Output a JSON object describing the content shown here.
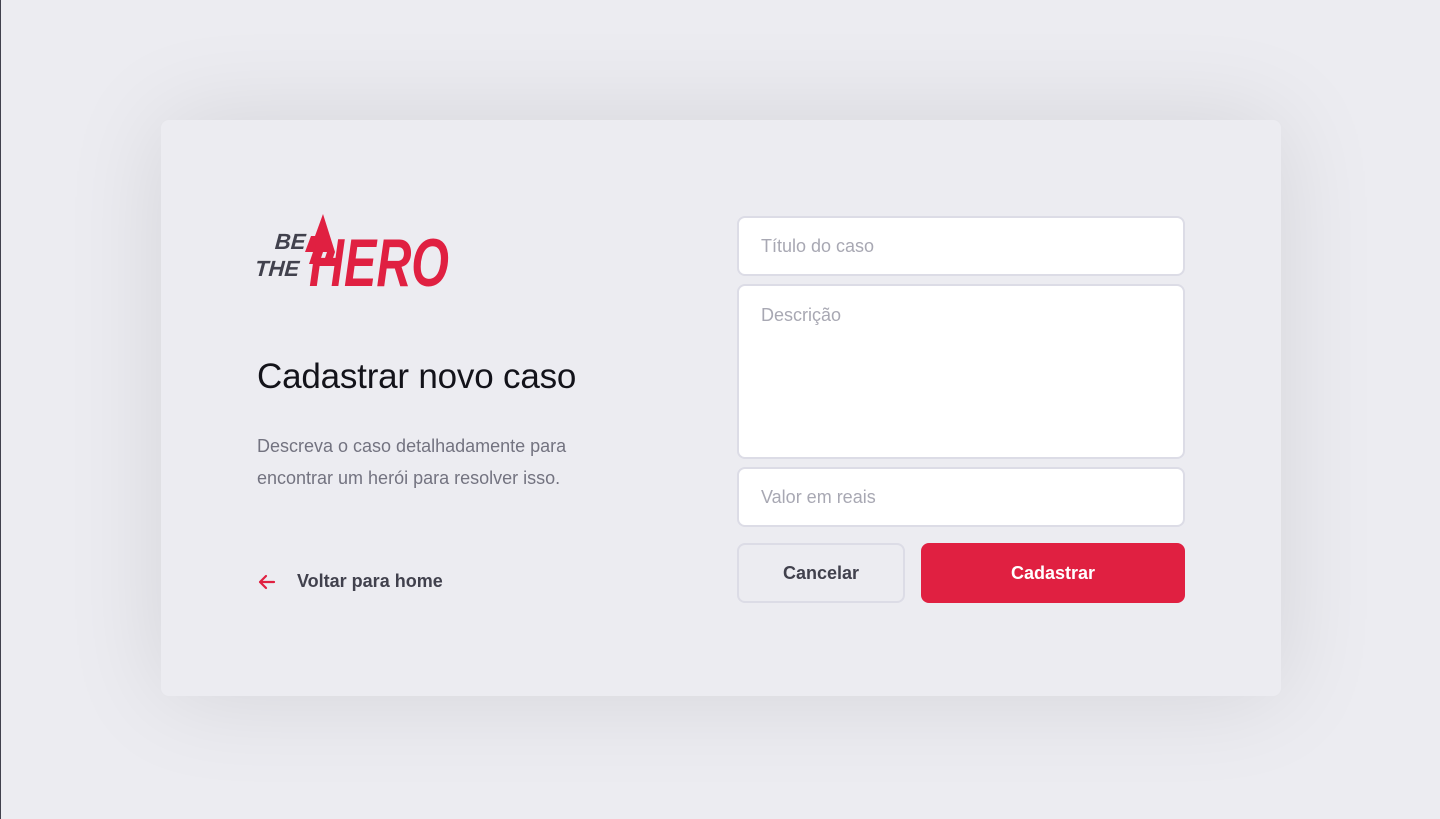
{
  "logo": {
    "line1": "BE",
    "line2": "THE",
    "word": "HERO"
  },
  "page": {
    "title": "Cadastrar novo caso",
    "description": "Descreva o caso detalhadamente para encontrar um herói para resolver isso.",
    "back_link_label": "Voltar para home"
  },
  "form": {
    "title_placeholder": "Título do caso",
    "title_value": "",
    "description_placeholder": "Descrição",
    "description_value": "",
    "value_placeholder": "Valor em reais",
    "value_value": "",
    "cancel_label": "Cancelar",
    "submit_label": "Cadastrar"
  },
  "icons": {
    "back": "arrow-left-icon"
  },
  "colors": {
    "accent": "#E02041",
    "background": "#ECECF1",
    "title_text": "#13131A",
    "muted_text": "#737380",
    "dark_text": "#41414D",
    "border": "#DCDCE6"
  }
}
